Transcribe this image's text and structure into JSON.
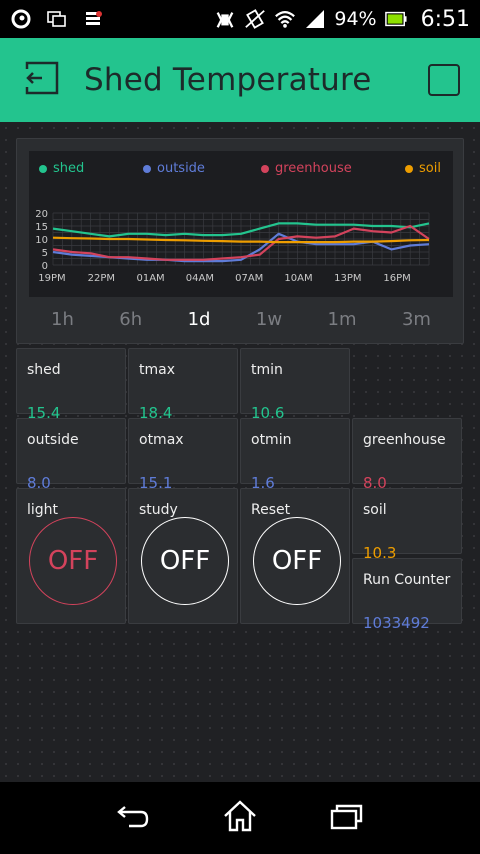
{
  "status": {
    "battery_percent": "94%",
    "time": "6:51"
  },
  "header": {
    "title": "Shed Temperature"
  },
  "chart": {
    "legend": [
      {
        "name": "shed",
        "color": "#23c48e"
      },
      {
        "name": "outside",
        "color": "#5f7cd8"
      },
      {
        "name": "greenhouse",
        "color": "#d3435c"
      },
      {
        "name": "soil",
        "color": "#ed9d00"
      }
    ],
    "ranges": [
      "1h",
      "6h",
      "1d",
      "1w",
      "1m",
      "3m"
    ],
    "active_range": "1d"
  },
  "chart_data": {
    "type": "line",
    "x": [
      "19PM",
      "22PM",
      "01AM",
      "04AM",
      "07AM",
      "10AM",
      "13PM",
      "16PM"
    ],
    "yticks": [
      "0",
      "5",
      "10",
      "15",
      "20"
    ],
    "ylim": [
      0,
      20
    ],
    "series": [
      {
        "name": "shed",
        "color": "#23c48e",
        "values": [
          14,
          13,
          12,
          11,
          12,
          12,
          11.5,
          12,
          11.5,
          11.5,
          12,
          14,
          16,
          16,
          15.5,
          15.5,
          15.5,
          15,
          15,
          14.5,
          16
        ]
      },
      {
        "name": "outside",
        "color": "#5f7cd8",
        "values": [
          5,
          4,
          3.5,
          3,
          2.5,
          2,
          2,
          1.5,
          1.5,
          1.5,
          2,
          6,
          12,
          9,
          8,
          8,
          8,
          9,
          6,
          7.5,
          8
        ]
      },
      {
        "name": "greenhouse",
        "color": "#d3435c",
        "values": [
          6,
          5,
          4.5,
          3,
          3,
          2.5,
          2,
          2,
          2,
          2.5,
          3,
          4,
          10,
          11,
          10.5,
          11,
          14,
          13,
          12.5,
          15,
          10
        ]
      },
      {
        "name": "soil",
        "color": "#ed9d00",
        "values": [
          10.5,
          10.3,
          10.2,
          10,
          10,
          9.8,
          9.6,
          9.5,
          9.3,
          9.2,
          9,
          9,
          8.8,
          8.8,
          8.8,
          8.8,
          9,
          9,
          9.2,
          9.5,
          9.6
        ]
      }
    ]
  },
  "displays": {
    "shed": {
      "label": "shed",
      "value": "15.4",
      "color": "#23c48e"
    },
    "tmax": {
      "label": "tmax",
      "value": "18.4",
      "color": "#23c48e"
    },
    "tmin": {
      "label": "tmin",
      "value": "10.6",
      "color": "#23c48e"
    },
    "outside": {
      "label": "outside",
      "value": "8.0",
      "color": "#5f7cd8"
    },
    "otmax": {
      "label": "otmax",
      "value": "15.1",
      "color": "#5f7cd8"
    },
    "otmin": {
      "label": "otmin",
      "value": "1.6",
      "color": "#5f7cd8"
    },
    "greenhouse": {
      "label": "greenhouse",
      "value": "8.0",
      "color": "#d3435c"
    },
    "soil": {
      "label": "soil",
      "value": "10.3",
      "color": "#ed9d00"
    },
    "run_counter": {
      "label": "Run Counter",
      "value": "1033492",
      "color": "#5f7cd8"
    }
  },
  "buttons": {
    "light": {
      "label": "light",
      "state": "OFF",
      "color": "#d3435c"
    },
    "study": {
      "label": "study",
      "state": "OFF",
      "color": "#ffffff"
    },
    "reset": {
      "label": "Reset",
      "state": "OFF",
      "color": "#ffffff"
    }
  },
  "icons": {
    "status": [
      "vodafone-icon",
      "screen-mirror-icon",
      "notification-icon",
      "nfc-icon",
      "vibrate-icon",
      "wifi-icon",
      "signal-icon",
      "battery-icon"
    ],
    "nav": [
      "back-icon",
      "home-icon",
      "recents-icon"
    ]
  }
}
